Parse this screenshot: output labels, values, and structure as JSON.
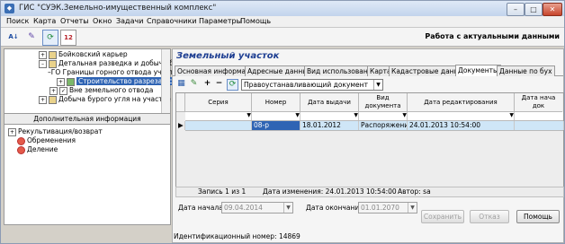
{
  "window": {
    "title": "ГИС \"СУЭК.Земельно-имущественный комплекс\""
  },
  "menu": [
    "Поиск",
    "Карта",
    "Отчеты",
    "Окно",
    "Задачи",
    "Справочники",
    "Параметры",
    "Помощь"
  ],
  "toolbar": {
    "mode_title": "Работа с актуальными данными"
  },
  "tree": {
    "items": [
      {
        "label": "Бойковский карьер"
      },
      {
        "label": "Детальная разведка и добыча б"
      },
      {
        "label": "Границы горного отвода участ"
      },
      {
        "label": "Строительство разреза пс"
      },
      {
        "label": "Вне земельного отвода"
      },
      {
        "label": "Добыча бурого угля на участке \"С"
      }
    ],
    "caption": "Дополнительная информация",
    "lower_items": [
      {
        "label": "Рекультивация/возврат"
      },
      {
        "label": "Обременения"
      },
      {
        "label": "Деление"
      }
    ]
  },
  "panel": {
    "title": "Земельный участок",
    "tabs": [
      "Основная информация",
      "Адресные данные",
      "Вид использования",
      "Карта",
      "Кадастровые данные",
      "Документы",
      "Данные по бух"
    ],
    "active_tab_index": 5,
    "doc_type": "Правоустанавливающий документ"
  },
  "grid": {
    "columns": [
      "Серия",
      "Номер",
      "Дата выдачи",
      "Вид документа",
      "Дата редактирования",
      "Дата нача док"
    ],
    "rows": [
      {
        "series": "",
        "number": "08-р",
        "issue_date": "18.01.2012",
        "doc_kind": "Распоряжение",
        "edit_date": "24.01.2013 10:54:00",
        "start": ""
      }
    ]
  },
  "status": {
    "record": "Запись 1 из 1",
    "changed": "Дата изменения: 24.01.2013 10:54:00",
    "author": "Автор: sa"
  },
  "bottom": {
    "start_label": "Дата начала",
    "start_value": "09.04.2014",
    "end_label": "Дата окончания",
    "end_value": "01.01.2070",
    "save": "Сохранить",
    "cancel": "Отказ",
    "help": "Помощь"
  },
  "footer": "Идентификационный номер: 14869"
}
